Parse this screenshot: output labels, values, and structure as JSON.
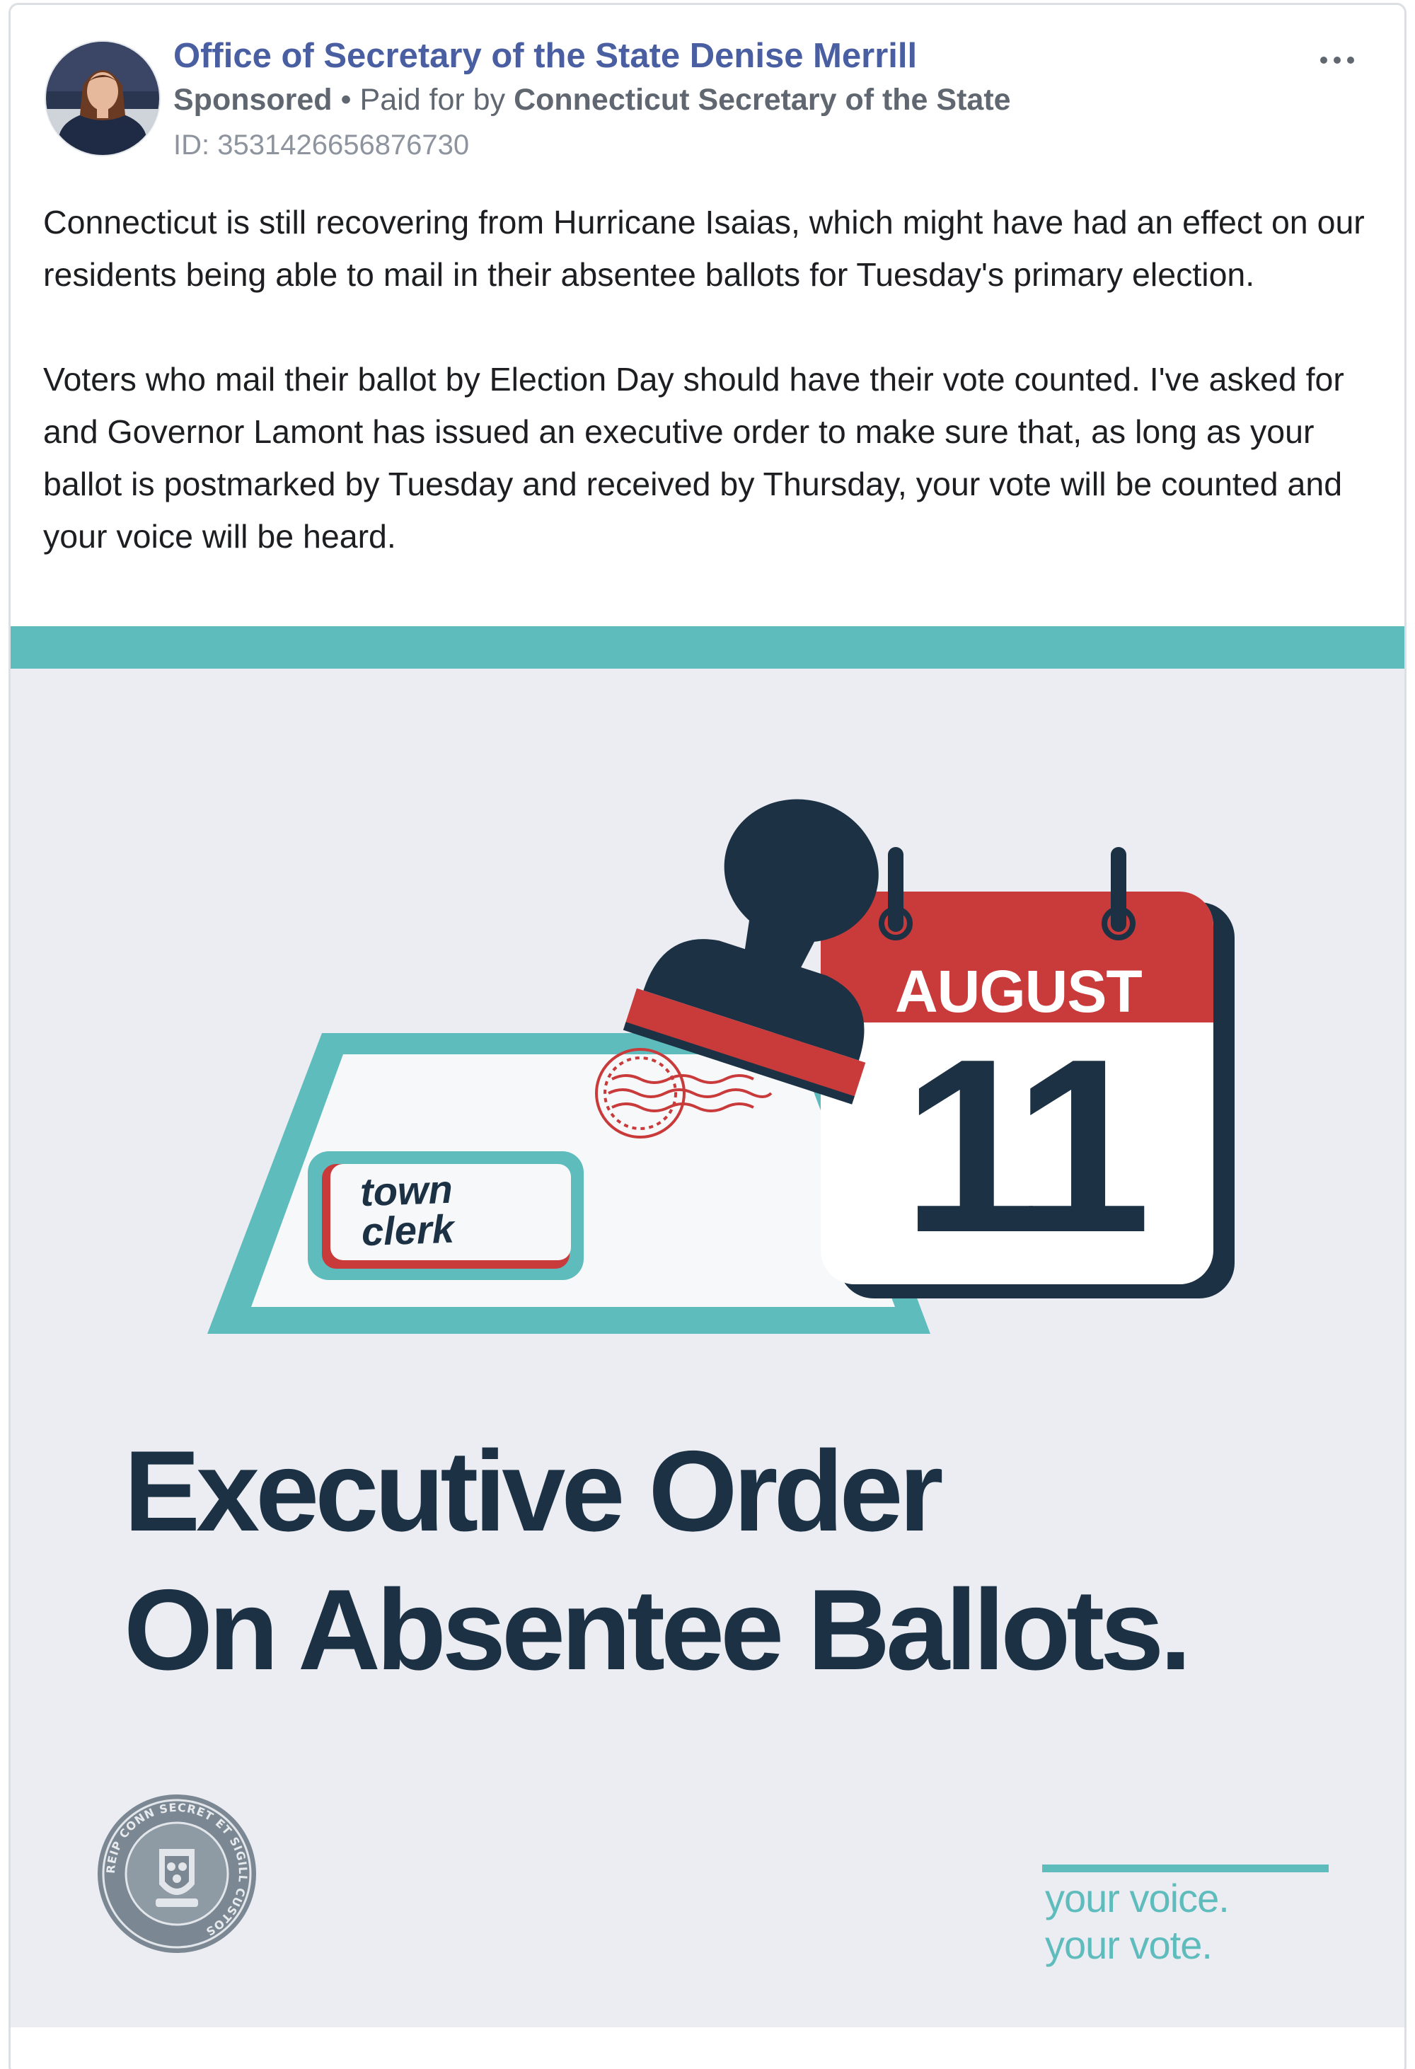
{
  "post": {
    "advertiser_name": "Office of Secretary of the State Denise Merrill",
    "sponsored_label": "Sponsored",
    "separator": "•",
    "paid_for_prefix": "Paid for by",
    "paid_for_by": "Connecticut Secretary of the State",
    "ad_id": "ID: 3531426656876730",
    "more_icon": "more-options-icon",
    "paragraphs": [
      "Connecticut is still recovering from Hurricane Isaias, which might have had an effect on our residents being able to mail in their absentee ballots for Tuesday's primary election.",
      "Voters who mail their ballot by Election Day should have their vote counted. I've asked for and Governor Lamont has issued an executive order to make sure that, as long as your ballot is postmarked by Tuesday and received by Thursday, your vote will be counted and your voice will be heard."
    ]
  },
  "creative": {
    "calendar_month": "AUGUST",
    "calendar_day": "11",
    "envelope_label_line1": "town",
    "envelope_label_line2": "clerk",
    "headline_line1": "Executive Order",
    "headline_line2": "On Absentee Ballots.",
    "tagline_line1": "your voice.",
    "tagline_line2": "your vote.",
    "seal_text": "REIP CONN SECRET ET SIGILL CUSTOS",
    "colors": {
      "teal": "#5fbcbd",
      "navy": "#1c3144",
      "red": "#c93a3a",
      "background": "#ebedf2",
      "link_blue": "#4a5fa2"
    }
  }
}
